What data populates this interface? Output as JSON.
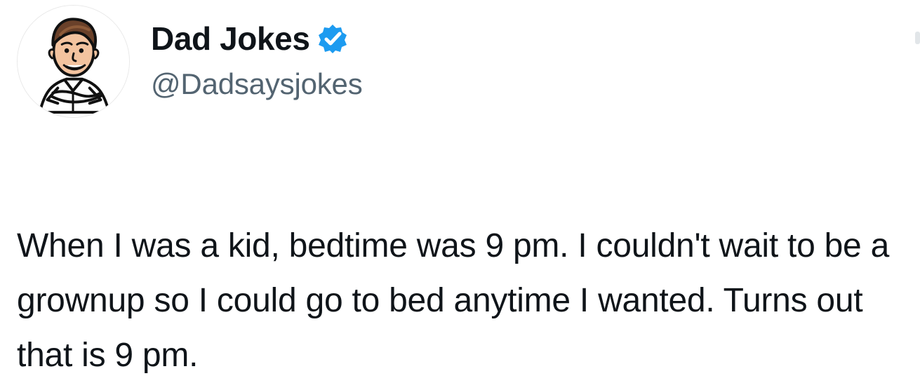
{
  "tweet": {
    "author": {
      "display_name": "Dad Jokes",
      "handle": "@Dadsaysjokes",
      "verified": true,
      "verified_badge_color": "#1d9bf0",
      "avatar_icon": "dad-avatar-icon"
    },
    "body": "When I was a kid, bedtime was 9 pm. I couldn't wait to be a grownup so I could go to bed anytime I wanted. Turns out that is 9 pm."
  },
  "colors": {
    "text_primary": "#0f1419",
    "text_secondary": "#536471",
    "background": "#ffffff"
  }
}
